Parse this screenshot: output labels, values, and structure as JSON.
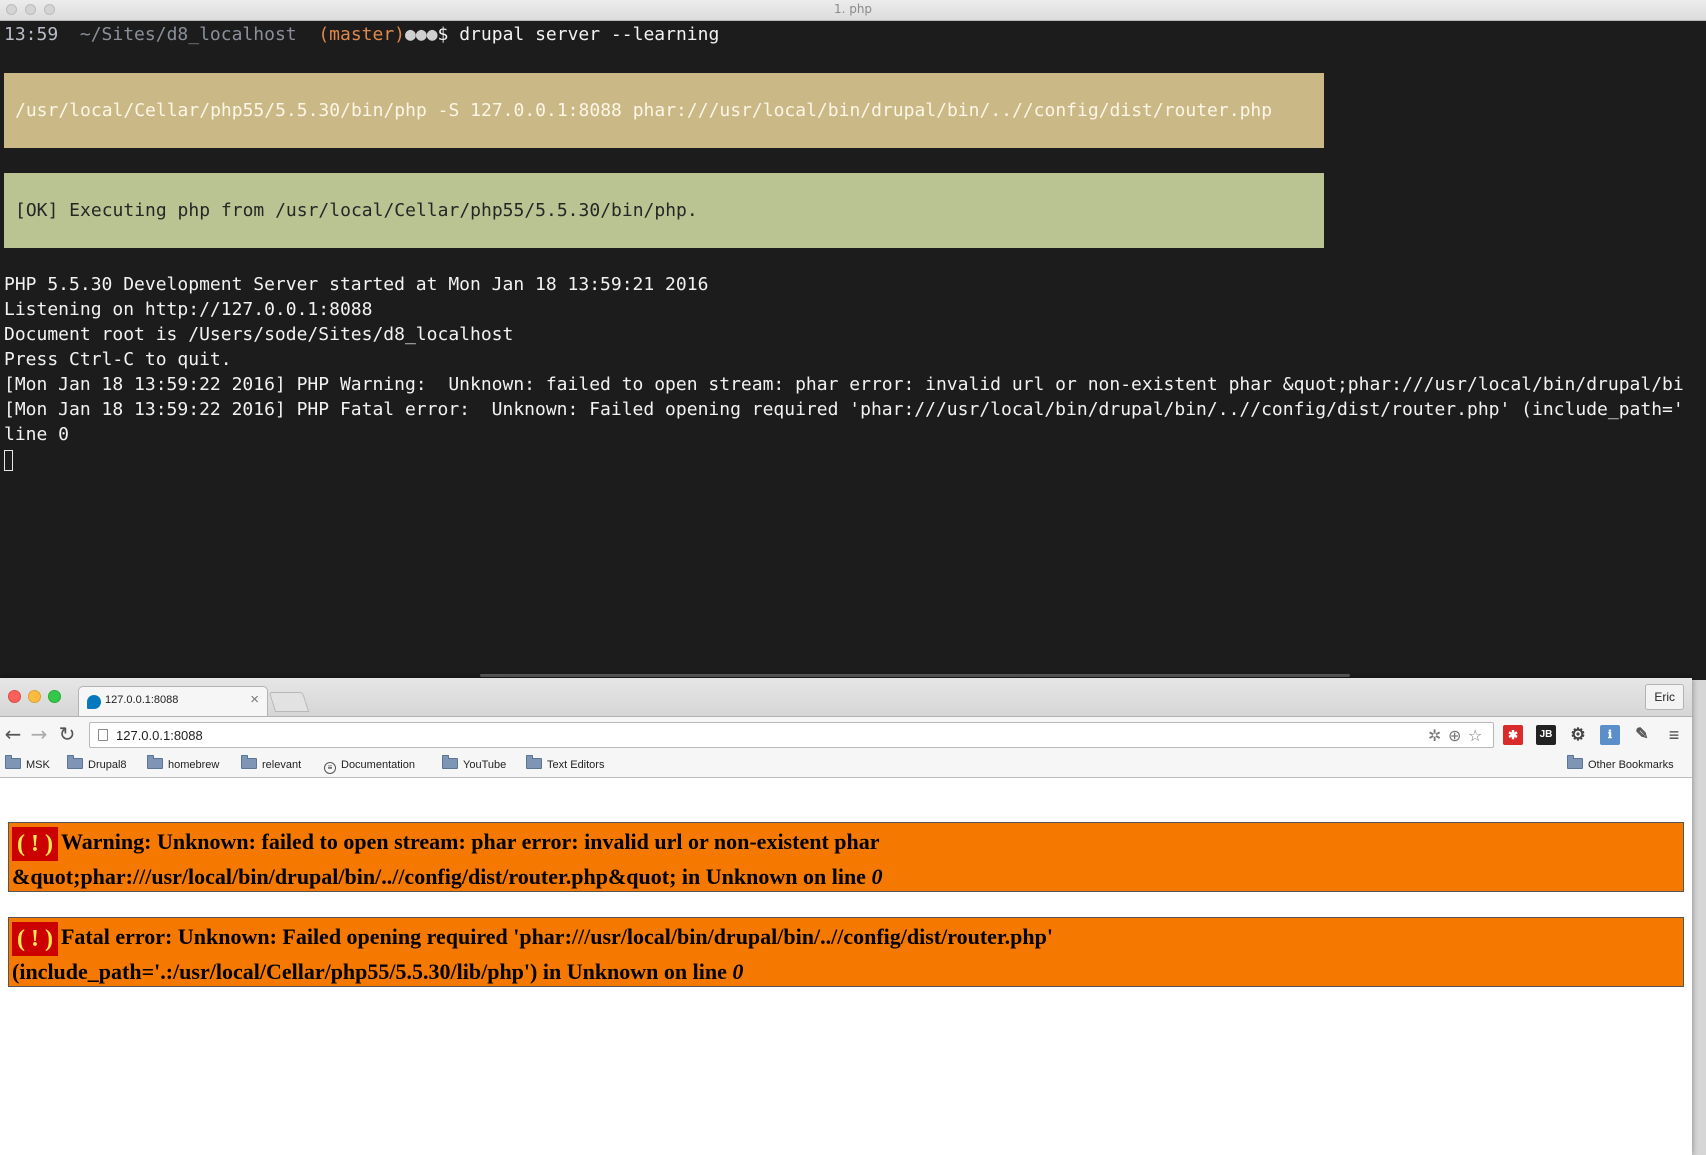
{
  "terminal": {
    "title": "1. php",
    "prompt": {
      "time": "13:59",
      "path": "~/Sites/d8_localhost",
      "branch": "(master)",
      "dots": "●●●",
      "symbol": "$",
      "command": "drupal server --learning"
    },
    "exec_command": "/usr/local/Cellar/php55/5.5.30/bin/php -S 127.0.0.1:8088 phar:///usr/local/bin/drupal/bin/..//config/dist/router.php",
    "ok_message": "[OK] Executing php from /usr/local/Cellar/php55/5.5.30/bin/php.",
    "log_lines": [
      "PHP 5.5.30 Development Server started at Mon Jan 18 13:59:21 2016",
      "Listening on http://127.0.0.1:8088",
      "Document root is /Users/sode/Sites/d8_localhost",
      "Press Ctrl-C to quit.",
      "[Mon Jan 18 13:59:22 2016] PHP Warning:  Unknown: failed to open stream: phar error: invalid url or non-existent phar &quot;phar:///usr/local/bin/drupal/bi",
      "[Mon Jan 18 13:59:22 2016] PHP Fatal error:  Unknown: Failed opening required 'phar:///usr/local/bin/drupal/bin/..//config/dist/router.php' (include_path='",
      "line 0"
    ]
  },
  "browser": {
    "tab_title": "127.0.0.1:8088",
    "tab_close": "×",
    "profile_name": "Eric",
    "url": "127.0.0.1:8088",
    "nav": {
      "back": "←",
      "forward": "→",
      "reload": "↻",
      "menu": "≡"
    },
    "bookmarks": [
      {
        "label": "MSK",
        "icon": "folder-icon"
      },
      {
        "label": "Drupal8",
        "icon": "folder-icon"
      },
      {
        "label": "homebrew",
        "icon": "folder-icon"
      },
      {
        "label": "relevant",
        "icon": "folder-icon"
      },
      {
        "label": "Documentation",
        "icon": "page-icon"
      },
      {
        "label": "YouTube",
        "icon": "folder-icon"
      },
      {
        "label": "Text Editors",
        "icon": "folder-icon"
      }
    ],
    "other_bookmarks": "Other Bookmarks",
    "errors": [
      {
        "icon": "( ! )",
        "line1": "Warning: Unknown: failed to open stream: phar error: invalid url or non-existent phar",
        "line2": "&quot;phar:///usr/local/bin/drupal/bin/..//config/dist/router.php&quot; in Unknown on line ",
        "line_no": "0"
      },
      {
        "icon": "( ! )",
        "line1": "Fatal error: Unknown: Failed opening required 'phar:///usr/local/bin/drupal/bin/..//config/dist/router.php'",
        "line2": "(include_path='.:/usr/local/Cellar/php55/5.5.30/lib/php') in Unknown on line ",
        "line_no": "0"
      }
    ]
  },
  "colors": {
    "terminal_bg": "#1c1c1c",
    "cmd_box": "#cbb887",
    "ok_box": "#b9c492",
    "php_error_bg": "#f57900",
    "php_error_icon_bg": "#cc0000",
    "php_error_icon_fg": "#fce94f"
  }
}
